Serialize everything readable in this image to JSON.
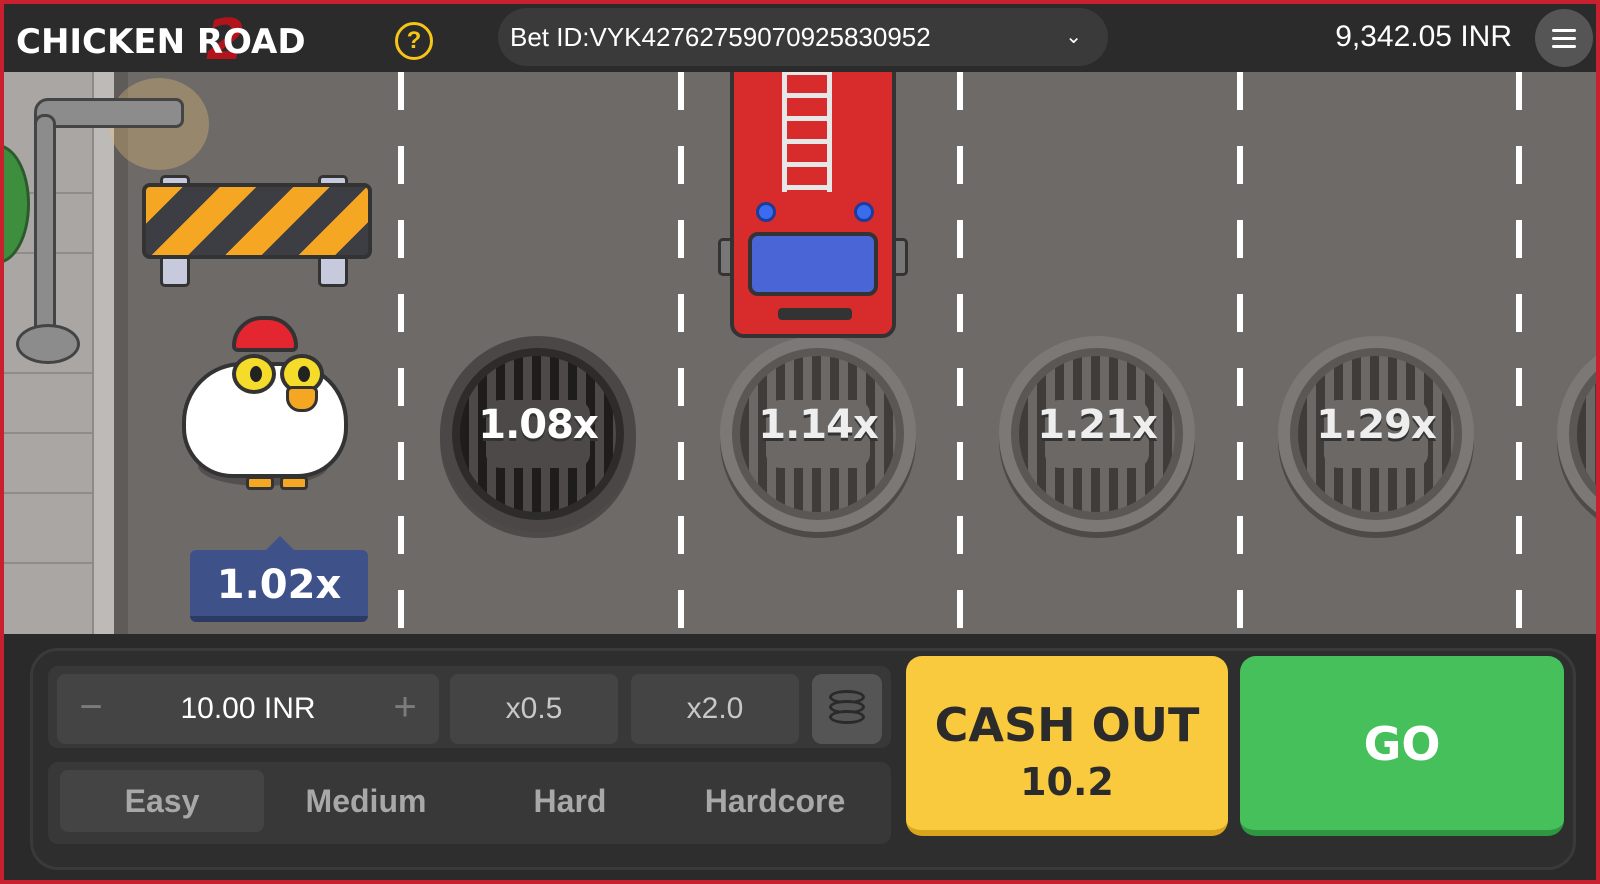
{
  "header": {
    "logo_text": "CHICKEN ROAD",
    "logo_number": "2",
    "help_label": "?",
    "bet_id_label": "Bet ID:",
    "bet_id_value": "VYK42762759070925830952",
    "balance": "9,342.05 INR"
  },
  "game": {
    "current_multiplier": "1.02x",
    "lane_multipliers": [
      "1.08x",
      "1.14x",
      "1.21x",
      "1.29x"
    ]
  },
  "controls": {
    "stake_minus": "−",
    "stake_amount": "10.00 INR",
    "stake_plus": "+",
    "half_label": "x0.5",
    "double_label": "x2.0",
    "difficulties": [
      "Easy",
      "Medium",
      "Hard",
      "Hardcore"
    ],
    "selected_difficulty": "Easy",
    "cashout_label": "CASH OUT",
    "cashout_value": "10.2",
    "go_label": "GO"
  },
  "colors": {
    "frame": "#c8202f",
    "cashout": "#f9c93e",
    "go": "#45c05a",
    "multiplier_badge": "#3e5289"
  }
}
